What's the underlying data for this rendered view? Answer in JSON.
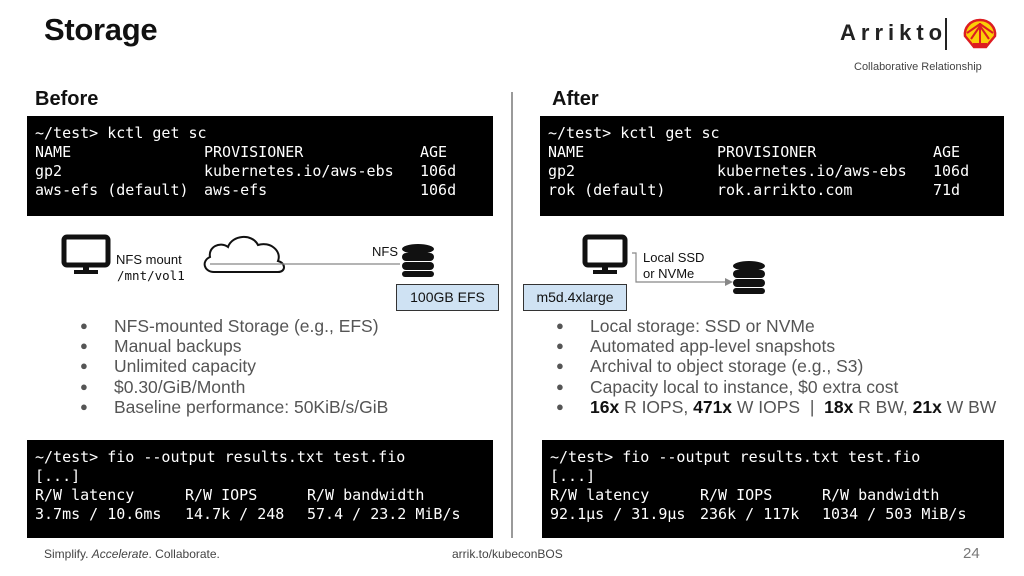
{
  "slide": {
    "title": "Storage",
    "brand": "Arrikto",
    "brand_tagline": "Collaborative Relationship",
    "page_number": "24"
  },
  "footer": {
    "part1": "Simplify. ",
    "part2": "Accelerate",
    "part3": ". Collaborate.",
    "url": "arrik.to/kubeconBOS"
  },
  "before": {
    "heading": "Before",
    "sc_terminal": [
      [
        "~/test> kctl get sc",
        "",
        ""
      ],
      [
        "NAME",
        "PROVISIONER",
        "AGE"
      ],
      [
        "gp2",
        "kubernetes.io/aws-ebs",
        "106d"
      ],
      [
        "aws-efs (default)",
        "aws-efs",
        "106d"
      ]
    ],
    "diagram": {
      "mount_label": "NFS mount",
      "mount_path": "/mnt/vol1",
      "link_label": "NFS",
      "storage_box": "100GB EFS"
    },
    "bullets": [
      "NFS-mounted Storage (e.g., EFS)",
      "Manual backups",
      "Unlimited capacity",
      "$0.30/GiB/Month",
      "Baseline performance: 50KiB/s/GiB"
    ],
    "fio_terminal": [
      [
        "~/test> fio --output results.txt test.fio",
        "",
        ""
      ],
      [
        "[...]",
        "",
        ""
      ],
      [
        "R/W latency",
        "R/W IOPS",
        "R/W bandwidth"
      ],
      [
        "3.7ms / 10.6ms",
        "14.7k / 248",
        "57.4 / 23.2 MiB/s"
      ]
    ]
  },
  "after": {
    "heading": "After",
    "sc_terminal": [
      [
        "~/test> kctl get sc",
        "",
        ""
      ],
      [
        "NAME",
        "PROVISIONER",
        "AGE"
      ],
      [
        "gp2",
        "kubernetes.io/aws-ebs",
        "106d"
      ],
      [
        "rok (default)",
        "rok.arrikto.com",
        "71d"
      ]
    ],
    "diagram": {
      "link_label_1": "Local SSD",
      "link_label_2": "or NVMe",
      "instance_box": "m5d.4xlarge"
    },
    "bullets": [
      "Local storage: SSD or NVMe",
      "Automated app-level snapshots",
      "Archival to object storage (e.g., S3)",
      "Capacity local to instance, $0 extra cost"
    ],
    "perf_bullet": {
      "b1": "16x",
      "t1": " R IOPS, ",
      "b2": "471x",
      "t2": " W IOPS  |  ",
      "b3": "18x",
      "t3": " R BW, ",
      "b4": "21x",
      "t4": " W BW"
    },
    "fio_terminal": [
      [
        "~/test> fio --output results.txt test.fio",
        "",
        ""
      ],
      [
        "[...]",
        "",
        ""
      ],
      [
        "R/W latency",
        "R/W IOPS",
        "R/W bandwidth"
      ],
      [
        "92.1µs / 31.9µs",
        "236k / 117k",
        "1034 / 503 MiB/s"
      ]
    ]
  },
  "colors": {
    "terminal_bg": "#000000",
    "box_fill": "#cfe2f3",
    "shell_red": "#dd1d21",
    "shell_yellow": "#fbce07"
  },
  "icons": [
    "monitor-icon",
    "cloud-icon",
    "database-icon",
    "shell-logo-icon"
  ]
}
